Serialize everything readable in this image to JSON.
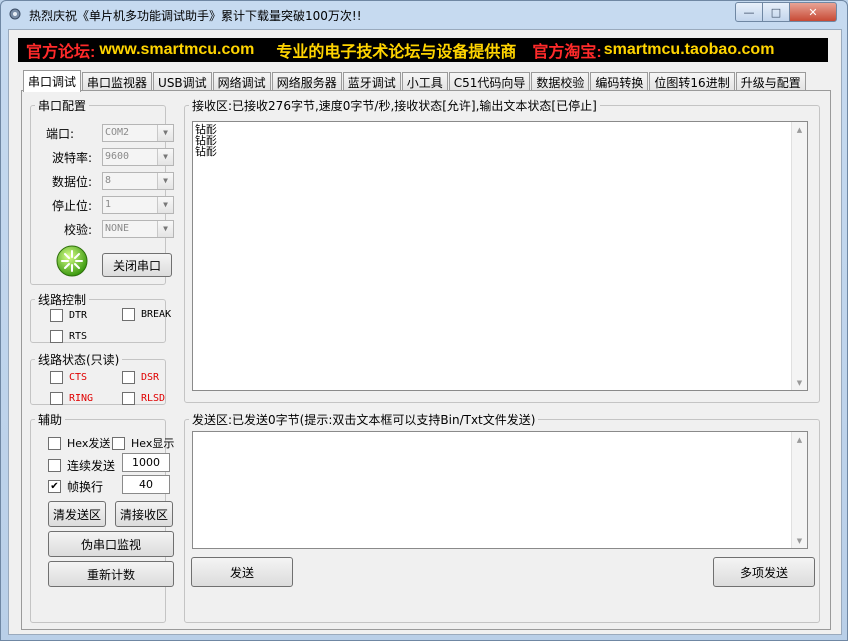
{
  "window": {
    "title": "热烈庆祝《单片机多功能调试助手》累计下载量突破100万次!!",
    "min_glyph": "—",
    "max_glyph": "□",
    "close_glyph": "✕"
  },
  "banner": {
    "forum_label": "官方论坛:",
    "forum_url": "www.smartmcu.com",
    "slogan": "专业的电子技术论坛与设备提供商",
    "shop_label": "官方淘宝:",
    "shop_url": "smartmcu.taobao.com"
  },
  "tabs": [
    "串口调试",
    "串口监视器",
    "USB调试",
    "网络调试",
    "网络服务器",
    "蓝牙调试",
    "小工具",
    "C51代码向导",
    "数据校验",
    "编码转换",
    "位图转16进制",
    "升级与配置"
  ],
  "serial_config": {
    "title": "串口配置",
    "port_label": "端口:",
    "port_value": "COM2",
    "baud_label": "波特率:",
    "baud_value": "9600",
    "databits_label": "数据位:",
    "databits_value": "8",
    "stopbits_label": "停止位:",
    "stopbits_value": "1",
    "parity_label": "校验:",
    "parity_value": "NONE",
    "close_port_button": "关闭串口"
  },
  "line_control": {
    "title": "线路控制",
    "dtr": "DTR",
    "brk": "BREAK",
    "rts": "RTS"
  },
  "line_status": {
    "title": "线路状态(只读)",
    "cts": "CTS",
    "dsr": "DSR",
    "ring": "RING",
    "rlsd": "RLSD"
  },
  "aux": {
    "title": "辅助",
    "hex_send": "Hex发送",
    "hex_display": "Hex显示",
    "continuous_send": "连续发送",
    "continuous_interval": "1000",
    "frame_newline": "帧换行",
    "frame_newline_checked": true,
    "frame_value": "40",
    "clear_send_button": "清发送区",
    "clear_recv_button": "清接收区",
    "virtual_monitor_button": "伪串口监视",
    "recount_button": "重新计数"
  },
  "receive": {
    "title": "接收区:已接收276字节,速度0字节/秒,接收状态[允许],输出文本状态[已停止]",
    "lines": [
      "钻耏",
      "钻耏",
      "钻耏"
    ]
  },
  "send": {
    "title": "发送区:已发送0字节(提示:双击文本框可以支持Bin/Txt文件发送)",
    "send_button": "发送",
    "multi_send_button": "多项发送"
  }
}
